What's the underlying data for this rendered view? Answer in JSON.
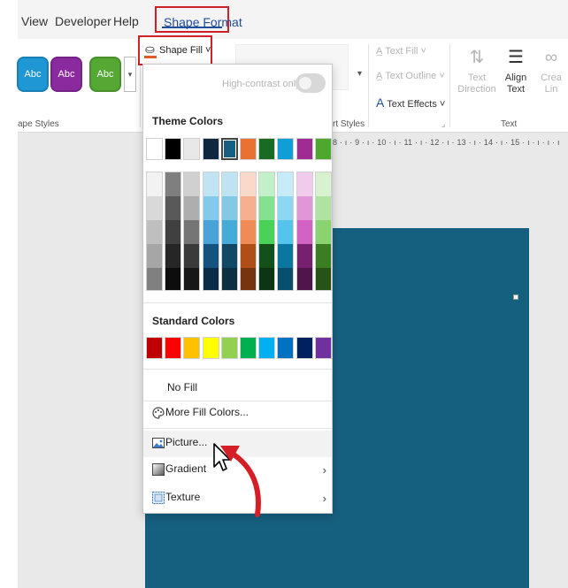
{
  "menubar": {
    "items": [
      "View",
      "Developer",
      "Help"
    ],
    "active": "Shape Format"
  },
  "ribbon": {
    "shape_styles": [
      {
        "label": "Abc",
        "color": "#1f97d4"
      },
      {
        "label": "Abc",
        "color": "#8b2a9e"
      },
      {
        "label": "Abc",
        "color": "#56a834"
      }
    ],
    "shape_styles_label": "ape Styles",
    "shape_fill_label": "Shape Fill",
    "art_styles_label": "rt Styles",
    "text_fill": "Text Fill",
    "text_outline": "Text Outline",
    "text_effects": "Text Effects",
    "text_direction": "Text Direction",
    "align_text": "Align Text",
    "create_link": "Crea Lin",
    "text_group_label": "Text"
  },
  "ruler": {
    "text": "8 · ı · 9 · ı · 10 · ı · 11 · ı · 12 · ı · 13 · ı · 14 · ı · 15 · ı · ı · ı · ı"
  },
  "dropdown": {
    "high_contrast_label": "High-contrast only",
    "theme_colors_title": "Theme Colors",
    "standard_colors_title": "Standard Colors",
    "theme_colors": [
      {
        "base": "#ffffff",
        "shades": [
          "#f2f2f2",
          "#d9d9d9",
          "#bfbfbf",
          "#a6a6a6",
          "#808080"
        ]
      },
      {
        "base": "#000000",
        "shades": [
          "#7f7f7f",
          "#595959",
          "#404040",
          "#262626",
          "#0d0d0d"
        ]
      },
      {
        "base": "#e8e8e8",
        "shades": [
          "#d0d0d0",
          "#aeaeae",
          "#757575",
          "#3a3a3a",
          "#171717"
        ]
      },
      {
        "base": "#0e2841",
        "shades": [
          "#c1e4f5",
          "#83c9ec",
          "#4aa3d8",
          "#14527f",
          "#0a2d47"
        ]
      },
      {
        "base": "#156082",
        "shades": [
          "#c0e3f2",
          "#83c8e5",
          "#45acd8",
          "#114863",
          "#0b3042"
        ]
      },
      {
        "base": "#e97132",
        "shades": [
          "#fad9c8",
          "#f6b08f",
          "#f08b58",
          "#b14d17",
          "#76340f"
        ]
      },
      {
        "base": "#196b24",
        "shades": [
          "#c2f0c8",
          "#85e18f",
          "#48d258",
          "#13501b",
          "#0c3612"
        ]
      },
      {
        "base": "#0f9ed5",
        "shades": [
          "#c6ebf9",
          "#8dd7f4",
          "#54c4ee",
          "#0b77a0",
          "#074f6a"
        ]
      },
      {
        "base": "#a02b93",
        "shades": [
          "#f0cbeb",
          "#e196d8",
          "#d263c5",
          "#782070",
          "#50154a"
        ]
      },
      {
        "base": "#4ea72e",
        "shades": [
          "#d8f1cf",
          "#b1e3a0",
          "#89d471",
          "#3a7d22",
          "#275317"
        ]
      }
    ],
    "selected_theme_index": 4,
    "standard_colors": [
      "#c00000",
      "#ff0000",
      "#ffc000",
      "#ffff00",
      "#92d050",
      "#00b050",
      "#00b0f0",
      "#0070c0",
      "#002060",
      "#7030a0"
    ],
    "no_fill": "No Fill",
    "more_fill_colors": "More Fill Colors...",
    "picture": "Picture...",
    "gradient": "Gradient",
    "texture": "Texture"
  }
}
